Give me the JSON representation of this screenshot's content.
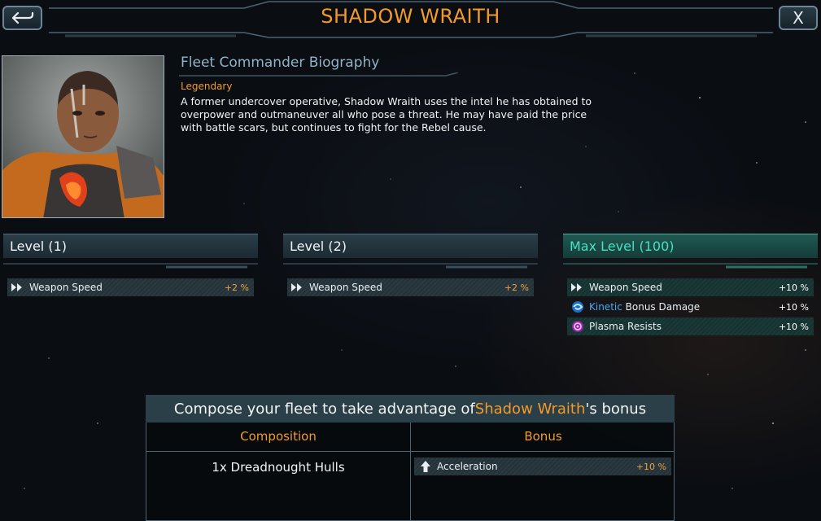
{
  "header": {
    "title": "SHADOW WRAITH",
    "close_label": "X"
  },
  "bio": {
    "title": "Fleet Commander Biography",
    "rarity": "Legendary",
    "text": "A former undercover operative, Shadow Wraith uses the intel he has obtained to overpower and outmaneuver all who pose a threat. He may have paid the price with battle scars, but continues to fight for the Rebel cause."
  },
  "levels": [
    {
      "title": "Level (1)",
      "stats": [
        {
          "icon": "double-chevron-icon",
          "label": "Weapon Speed",
          "value": "+2 %"
        }
      ]
    },
    {
      "title": "Level (2)",
      "stats": [
        {
          "icon": "double-chevron-icon",
          "label": "Weapon Speed",
          "value": "+2 %"
        }
      ]
    },
    {
      "title": "Max Level (100)",
      "stats": [
        {
          "icon": "double-chevron-icon",
          "label": "Weapon Speed",
          "value": "+10 %"
        },
        {
          "icon": "kinetic-icon",
          "label_prefix": "Kinetic",
          "label": " Bonus Damage",
          "value": "+10 %"
        },
        {
          "icon": "plasma-icon",
          "label": "Plasma Resists",
          "value": "+10 %"
        }
      ]
    }
  ],
  "composition": {
    "heading_prefix": "Compose your fleet to take advantage of ",
    "heading_name": "Shadow Wraith",
    "heading_suffix": "'s bonus",
    "col_composition": "Composition",
    "col_bonus": "Bonus",
    "item": "1x Dreadnought Hulls",
    "bonus": {
      "icon": "arrow-up-icon",
      "label": "Acceleration",
      "value": "+10 %"
    }
  },
  "colors": {
    "accent": "#f39a2a",
    "teal": "#47e0c4",
    "kinetic": "#49a8f0",
    "plasma": "#e06de8"
  }
}
